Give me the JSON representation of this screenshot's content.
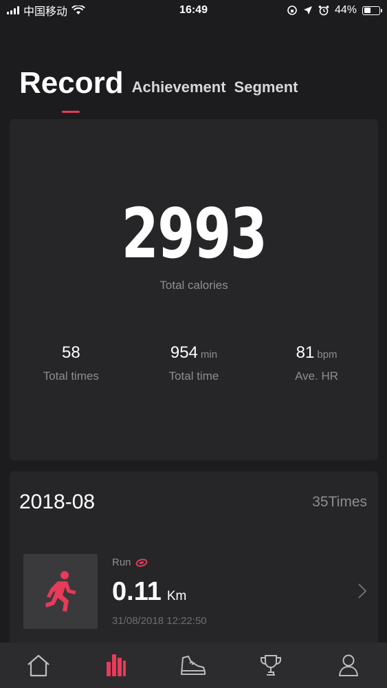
{
  "status_bar": {
    "carrier": "中国移动",
    "time": "16:49",
    "battery": "44%",
    "battery_level": 0.44
  },
  "tabs": [
    {
      "label": "Record",
      "active": true
    },
    {
      "label": "Achievement",
      "active": false
    },
    {
      "label": "Segment",
      "active": false
    }
  ],
  "summary": {
    "total_calories": "2993",
    "total_calories_label": "Total calories",
    "stats": [
      {
        "value": "58",
        "unit": "",
        "label": "Total times"
      },
      {
        "value": "954",
        "unit": "min",
        "label": "Total time"
      },
      {
        "value": "81",
        "unit": "bpm",
        "label": "Ave. HR"
      }
    ]
  },
  "month": {
    "title": "2018-08",
    "count": "35Times",
    "activity": {
      "type": "Run",
      "distance": "0.11",
      "unit": "Km",
      "datetime": "31/08/2018 12:22:50"
    }
  },
  "nav": [
    {
      "icon": "home-icon",
      "active": false
    },
    {
      "icon": "stats-icon",
      "active": true
    },
    {
      "icon": "shoe-icon",
      "active": false
    },
    {
      "icon": "trophy-icon",
      "active": false
    },
    {
      "icon": "profile-icon",
      "active": false
    }
  ],
  "colors": {
    "accent": "#e83a59",
    "background": "#1c1c1e",
    "card": "#262628",
    "muted": "#8e8e93"
  }
}
